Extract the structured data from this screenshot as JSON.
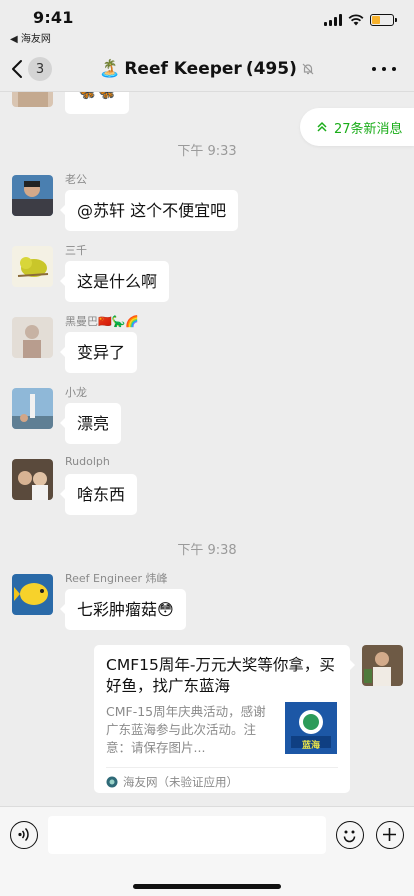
{
  "status_bar": {
    "time": "9:41",
    "back_app": "◀ 海友网"
  },
  "nav": {
    "unread_count": "3",
    "title_emoji": "🏝️",
    "title": "Reef Keeper",
    "member_count": "(495)"
  },
  "new_messages_label": "27条新消息",
  "timestamps": [
    "下午 9:33",
    "下午 9:38"
  ],
  "messages": [
    {
      "sender": "老公",
      "text": "@苏轩 这个不便宜吧"
    },
    {
      "sender": "三千",
      "text": "这是什么啊"
    },
    {
      "sender": "黑曼巴🇨🇳🦕🌈",
      "text": "变异了"
    },
    {
      "sender": "小龙",
      "text": "漂亮"
    },
    {
      "sender": "Rudolph",
      "text": "啥东西"
    },
    {
      "sender": "Reef Engineer 炜峰",
      "text": "七彩肿瘤菇😳"
    }
  ],
  "partial_message": {
    "text": "🦋🦋"
  },
  "link_card": {
    "title": "CMF15周年-万元大奖等你拿，买好鱼，找广东蓝海",
    "description": "CMF-15周年庆典活动，感谢广东蓝海参与此次活动。注意：请保存图片...",
    "source": "海友网（未验证应用）",
    "thumb_text": "蓝海"
  },
  "input": {
    "placeholder": ""
  },
  "colors": {
    "accent": "#1aad19",
    "bubble": "#ffffff",
    "background": "#ededed"
  }
}
